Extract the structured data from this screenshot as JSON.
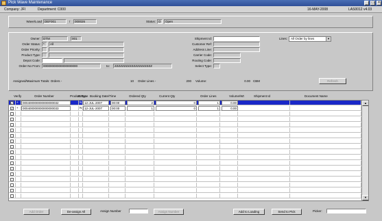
{
  "window": {
    "title": "Pick Wave Maintenance",
    "minimize": "_",
    "maximize": "□",
    "close": "×"
  },
  "info": {
    "company": "Company: JFI",
    "department": "Department: C000",
    "date": "16-MAY-2008",
    "program": "LAS0012 v4.03"
  },
  "wave": {
    "label": "Wave/Load",
    "code": "DEF001",
    "sep": "/",
    "number": "000026",
    "status_label": "Status:",
    "status_code": "O",
    "status_text": "Open"
  },
  "filters": {
    "owner_label": "Owner:",
    "owner_value": "DTM",
    "owner_code": "001",
    "order_status_label": "Order Status:",
    "order_status_code": "*",
    "order_status_text": "All",
    "order_priority_label": "Order Priority:",
    "product_type_label": "Product Type:",
    "depot_code_label": "Depot Code:",
    "order_no_from_label": "Order No From:",
    "order_no_from": "00000000000000000000",
    "to_label": "to:",
    "order_no_to": "ZZZZZZZZZZZZZZZZZZZZ",
    "shipment_label": "Shipment Id:",
    "customer_ref_label": "Customer Ref:",
    "address_line_label": "Address Line:",
    "carrier_code_label": "Carrier Code:",
    "routing_code_label": "Routing Code:",
    "select_type_label": "Select Type:",
    "lines_label": "Lines:",
    "lines_value": "All Order by lines"
  },
  "totals": {
    "label": "Assigned/Maximum Totals:  Orders -",
    "orders": "10",
    "order_lines_label": "Order Lines -",
    "order_lines": "200",
    "volume_label": "Volume:",
    "volume": "0.00",
    "unit": "CBM",
    "refresh_button": "Refresh"
  },
  "table": {
    "columns": [
      "Verify",
      "Order Number",
      "Product Type",
      "Status",
      "Booking Date/Time",
      "Ordered Qty",
      "Current Qty",
      "Order Lines",
      "Volume/Wt",
      "Shipment Id",
      "Document Name"
    ],
    "rows": [
      {
        "verify": true,
        "flag": "+",
        "order": "000400000000000000032",
        "ptype": "",
        "status": "N",
        "date": "12-JUL-2007",
        "time": "00:00",
        "ordered": "2",
        "current": "0",
        "lines": "1",
        "volume": "0.00"
      },
      {
        "verify": true,
        "flag": "+",
        "order": "000400000000000000033",
        "ptype": "",
        "status": "N",
        "date": "12-JUL-2007",
        "time": "00:00",
        "ordered": "1",
        "current": "0",
        "lines": "1",
        "volume": "0.00"
      }
    ]
  },
  "footer": {
    "add_btn": "Add Order",
    "deassign_btn": "De-assign All",
    "assign_number_label": "Assign Number",
    "assign_number_btn": "Assign Number",
    "add_loading_btn": "Add to Loading",
    "send_pick_btn": "Send to Pick",
    "picker_label": "Picker:"
  }
}
